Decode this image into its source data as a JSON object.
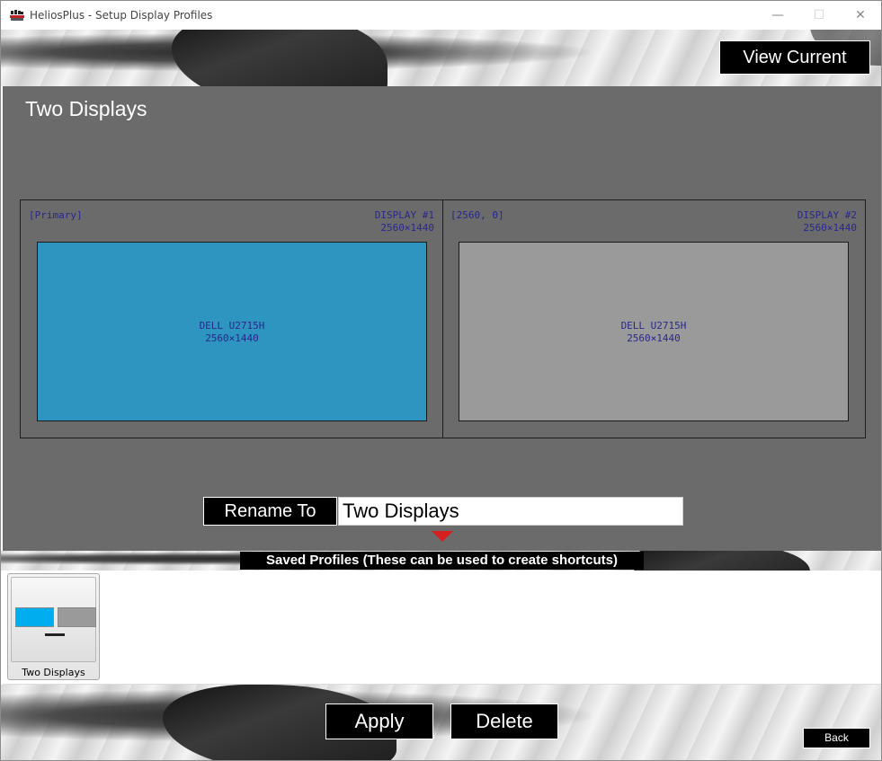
{
  "window": {
    "title": "HeliosPlus - Setup Display Profiles",
    "min_glyph": "—",
    "max_glyph": "☐",
    "close_glyph": "✕"
  },
  "header": {
    "view_current_label": "View Current"
  },
  "profile": {
    "name": "Two Displays",
    "displays": [
      {
        "corner_left": "[Primary]",
        "display_label": "DISPLAY #1",
        "resolution": "2560×1440",
        "monitor_name": "DELL U2715H",
        "monitor_resolution": "2560×1440",
        "color": "#2e95c0"
      },
      {
        "corner_left": "[2560, 0]",
        "display_label": "DISPLAY #2",
        "resolution": "2560×1440",
        "monitor_name": "DELL U2715H",
        "monitor_resolution": "2560×1440",
        "color": "#9a9a9a"
      }
    ]
  },
  "rename": {
    "button_label": "Rename To",
    "input_value": "Two Displays"
  },
  "saved_profiles": {
    "header_label": "Saved Profiles (These can be used to create shortcuts)",
    "items": [
      {
        "name": "Two Displays"
      }
    ]
  },
  "actions": {
    "apply_label": "Apply",
    "delete_label": "Delete",
    "back_label": "Back"
  },
  "colors": {
    "panel": "#6b6b6b",
    "accent_red": "#d42020",
    "primary_display": "#2e95c0",
    "thumb_primary": "#00adef"
  }
}
